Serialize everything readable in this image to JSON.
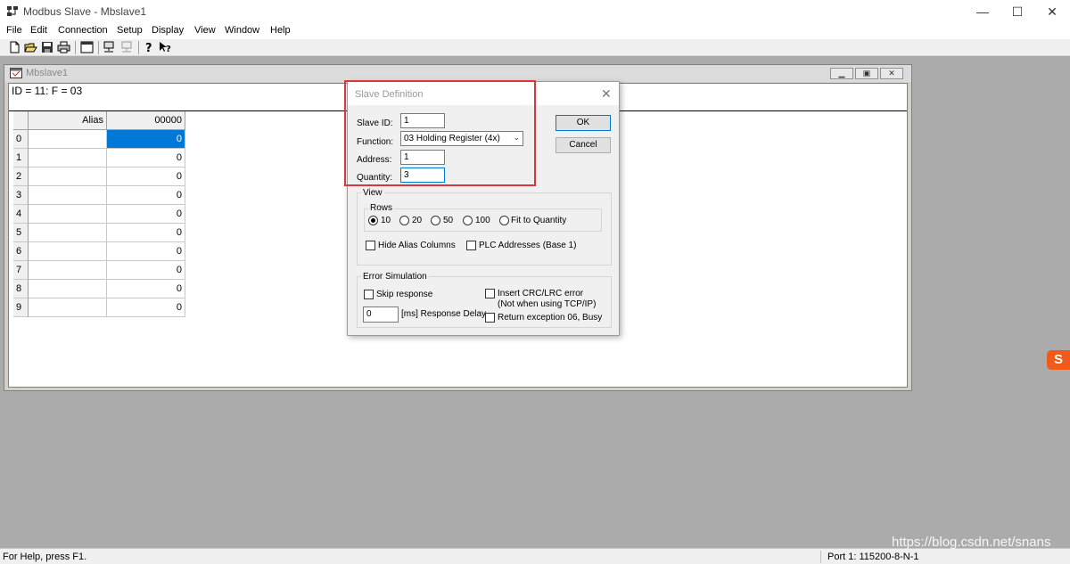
{
  "app": {
    "title": "Modbus Slave - Mbslave1",
    "window_controls": {
      "minimize": "—",
      "maximize": "☐",
      "close": "✕"
    }
  },
  "menu": [
    "File",
    "Edit",
    "Connection",
    "Setup",
    "Display",
    "View",
    "Window",
    "Help"
  ],
  "toolbar": {
    "icons": [
      "new-file-icon",
      "open-folder-icon",
      "save-icon",
      "print-icon",
      "window-icon",
      "connect-icon",
      "disconnect-icon",
      "help-icon",
      "context-help-icon"
    ]
  },
  "child": {
    "title": "Mbslave1",
    "header": "ID = 11: F = 03",
    "grid": {
      "alias_header": "Alias",
      "value_header": "00000",
      "rows": [
        {
          "num": "0",
          "value": "0"
        },
        {
          "num": "1",
          "value": "0"
        },
        {
          "num": "2",
          "value": "0"
        },
        {
          "num": "3",
          "value": "0"
        },
        {
          "num": "4",
          "value": "0"
        },
        {
          "num": "5",
          "value": "0"
        },
        {
          "num": "6",
          "value": "0"
        },
        {
          "num": "7",
          "value": "0"
        },
        {
          "num": "8",
          "value": "0"
        },
        {
          "num": "9",
          "value": "0"
        }
      ]
    }
  },
  "dialog": {
    "title": "Slave Definition",
    "close": "✕",
    "slave_id_label": "Slave ID:",
    "slave_id_value": "1",
    "function_label": "Function:",
    "function_value": "03 Holding Register (4x)",
    "address_label": "Address:",
    "address_value": "1",
    "quantity_label": "Quantity:",
    "quantity_value": "3",
    "ok_label": "OK",
    "cancel_label": "Cancel",
    "view": {
      "label": "View",
      "rows_label": "Rows",
      "row_options": [
        "10",
        "20",
        "50",
        "100",
        "Fit to Quantity"
      ],
      "selected_row_option": "10",
      "hide_alias": "Hide Alias Columns",
      "plc_addresses": "PLC Addresses (Base 1)"
    },
    "error_sim": {
      "label": "Error Simulation",
      "skip_response": "Skip response",
      "insert_crc": "Insert CRC/LRC error",
      "insert_crc_note": "(Not when using TCP/IP)",
      "delay_value": "0",
      "delay_label": "[ms] Response Delay",
      "return_exception": "Return exception 06, Busy"
    }
  },
  "side_badge": "S",
  "status": {
    "help": "For Help, press F1.",
    "port": "Port 1: 115200-8-N-1",
    "watermark": "https://blog.csdn.net/snans"
  }
}
